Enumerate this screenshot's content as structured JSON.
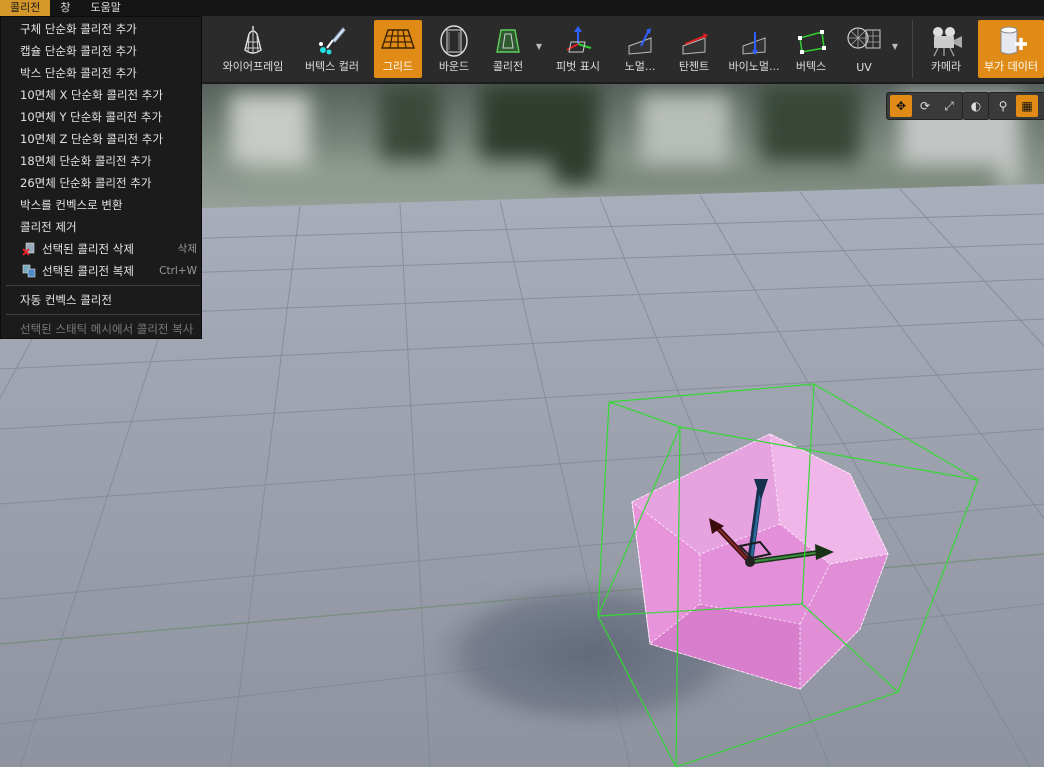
{
  "menubar": {
    "items": [
      {
        "label": "콜리전"
      },
      {
        "label": "창"
      },
      {
        "label": "도움말"
      }
    ]
  },
  "toolbar": {
    "buttons": [
      {
        "label": "와이어프레임",
        "icon": "wireframe-icon"
      },
      {
        "label": "버텍스 컬러",
        "icon": "vertex-color-icon"
      },
      {
        "label": "그리드",
        "icon": "grid-icon",
        "active": true
      },
      {
        "label": "바운드",
        "icon": "bounds-icon"
      },
      {
        "label": "콜리전",
        "icon": "collision-icon"
      },
      {
        "label": "피벗 표시",
        "icon": "pivot-icon"
      },
      {
        "label": "노멀...",
        "icon": "normals-icon"
      },
      {
        "label": "탄젠트",
        "icon": "tangents-icon"
      },
      {
        "label": "바이노멀...",
        "icon": "binormals-icon"
      },
      {
        "label": "버텍스",
        "icon": "vertices-icon"
      },
      {
        "label": "UV",
        "icon": "uv-icon"
      },
      {
        "label": "카메라",
        "icon": "camera-icon"
      },
      {
        "label": "부가 데이터",
        "icon": "additional-data-icon",
        "active": true
      }
    ]
  },
  "collision_menu": {
    "items": [
      {
        "label": "구체 단순화 콜리전 추가"
      },
      {
        "label": "캡슐 단순화 콜리전 추가"
      },
      {
        "label": "박스 단순화 콜리전 추가"
      },
      {
        "label": "10면체 X 단순화 콜리전 추가"
      },
      {
        "label": "10면체 Y 단순화 콜리전 추가"
      },
      {
        "label": "10면체 Z 단순화 콜리전 추가"
      },
      {
        "label": "18면체 단순화 콜리전 추가"
      },
      {
        "label": "26면체 단순화 콜리전 추가"
      },
      {
        "label": "박스를 컨벡스로 변환"
      },
      {
        "label": "콜리전 제거"
      },
      {
        "label": "선택된 콜리전 삭제",
        "shortcut": "삭제",
        "icon": "delete-collision-icon"
      },
      {
        "label": "선택된 콜리전 복제",
        "shortcut": "Ctrl+W",
        "icon": "duplicate-collision-icon"
      },
      {
        "label": "자동 컨벡스 콜리전"
      },
      {
        "label": "선택된 스태틱 메시에서 콜리전 복사",
        "disabled": true
      }
    ]
  },
  "colors": {
    "accent": "#e08b16",
    "menu_active": "#d6982a",
    "mesh": "#e79bdc",
    "bounds": "#3fd43f"
  }
}
